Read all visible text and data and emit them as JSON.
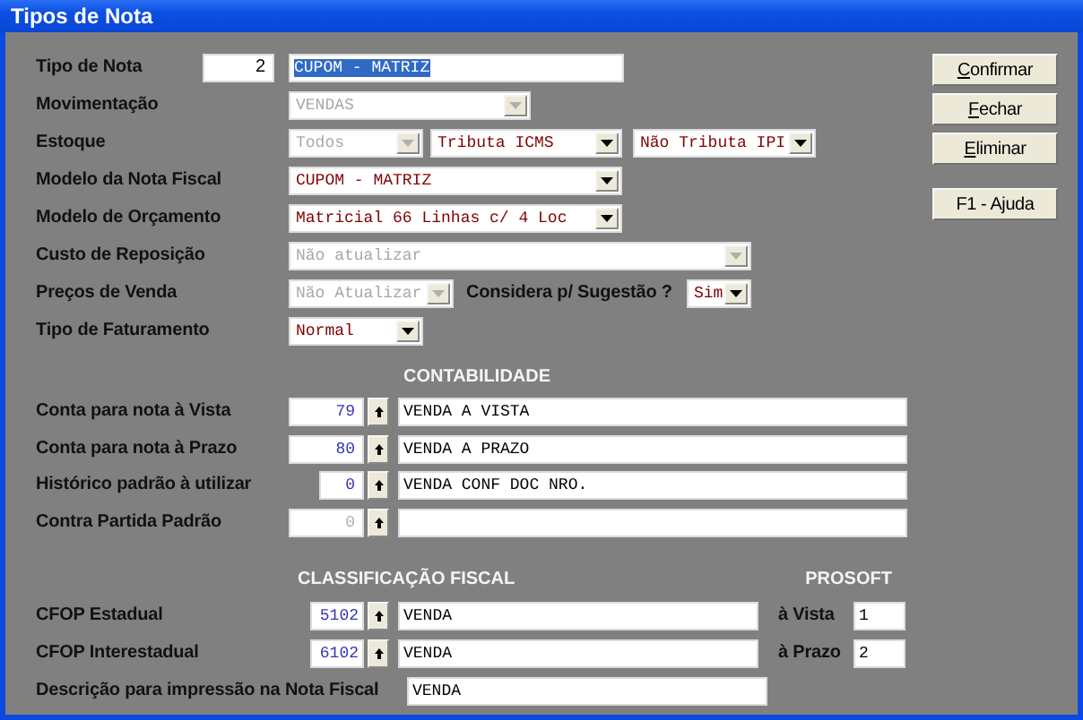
{
  "window": {
    "title": "Tipos de Nota"
  },
  "form": [
    {
      "label": "Tipo de Nota",
      "controls": [
        {
          "kind": "number",
          "value": "2"
        },
        {
          "kind": "text",
          "value": "CUPOM - MATRIZ",
          "selected": true
        }
      ]
    },
    {
      "label": "Movimentação",
      "controls": [
        {
          "kind": "combo",
          "value": "VENDAS",
          "disabled": true
        }
      ]
    },
    {
      "label": "Estoque",
      "controls": [
        {
          "kind": "combo",
          "value": "Todos",
          "disabled": true
        },
        {
          "kind": "combo",
          "value": "Tributa ICMS",
          "disabled": false
        },
        {
          "kind": "combo",
          "value": "Não Tributa IPI",
          "disabled": false
        }
      ]
    },
    {
      "label": "Modelo da Nota Fiscal",
      "controls": [
        {
          "kind": "combo",
          "value": "CUPOM - MATRIZ",
          "disabled": false
        }
      ]
    },
    {
      "label": "Modelo de Orçamento",
      "controls": [
        {
          "kind": "combo",
          "value": "Matricial 66 Linhas c/ 4 Loc",
          "disabled": false
        }
      ]
    },
    {
      "label": "Custo de Reposição",
      "controls": [
        {
          "kind": "combo",
          "value": "Não atualizar",
          "disabled": true
        }
      ]
    },
    {
      "label": "Preços de Venda",
      "controls": [
        {
          "kind": "combo",
          "value": "Não Atualizar",
          "disabled": true
        },
        {
          "kind": "label",
          "value": "Considera p/ Sugestão ?"
        },
        {
          "kind": "combo",
          "value": "Sim",
          "disabled": false
        }
      ]
    },
    {
      "label": "Tipo de Faturamento",
      "controls": [
        {
          "kind": "combo",
          "value": "Normal",
          "disabled": false
        }
      ]
    }
  ],
  "contabilidade": {
    "heading": "CONTABILIDADE",
    "rows": [
      {
        "label": "Conta para nota à Vista",
        "code": "79",
        "disabled": false,
        "description": "VENDA A VISTA"
      },
      {
        "label": "Conta para nota à Prazo",
        "code": "80",
        "disabled": false,
        "description": "VENDA A PRAZO"
      },
      {
        "label": "Histórico padrão à utilizar",
        "code": "0",
        "disabled": false,
        "description": "VENDA CONF DOC NRO."
      },
      {
        "label": "Contra Partida Padrão",
        "code": "0",
        "disabled": true
      }
    ]
  },
  "classificacao_fiscal": {
    "heading": "CLASSIFICAÇÃO FISCAL",
    "prosoft_heading": "PROSOFT",
    "rows": [
      {
        "label": "CFOP Estadual",
        "code": "5102",
        "description": "VENDA",
        "prosoft_label": "à Vista",
        "prosoft_value": "1"
      },
      {
        "label": "CFOP Interestadual",
        "code": "6102",
        "description": "VENDA",
        "prosoft_label": "à Prazo",
        "prosoft_value": "2"
      }
    ],
    "print_description": {
      "label": "Descrição para impressão na Nota Fiscal",
      "value": "VENDA"
    }
  },
  "buttons": [
    {
      "label": "Confirmar",
      "underline_first": true
    },
    {
      "label": "Fechar",
      "underline_first": true
    },
    {
      "label": "Eliminar",
      "underline_first": true
    },
    {
      "label": "F1 - Ajuda",
      "underline_first": false
    }
  ]
}
